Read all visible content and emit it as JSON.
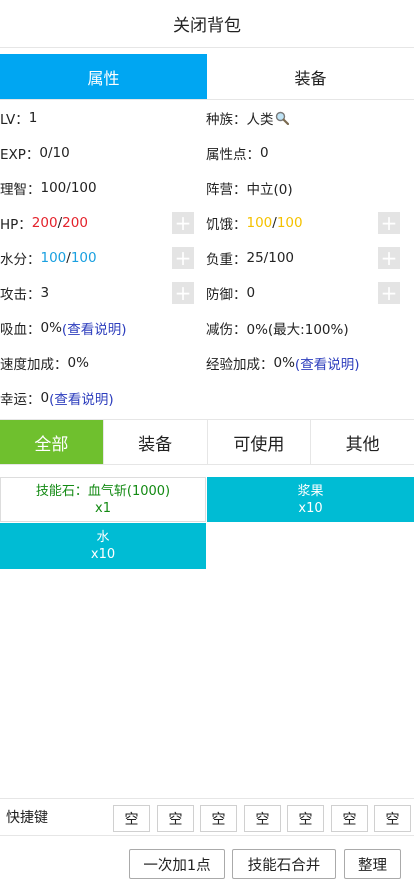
{
  "header": {
    "title": "关闭背包"
  },
  "tabs": [
    {
      "label": "属性"
    },
    {
      "label": "装备"
    }
  ],
  "stats": {
    "lv": {
      "label": "LV：",
      "value": "1"
    },
    "race": {
      "label": "种族：",
      "value": "人类"
    },
    "exp": {
      "label": "EXP：",
      "value": "0/10"
    },
    "attr_points": {
      "label": "属性点：",
      "value": "0"
    },
    "wisdom": {
      "label": "理智：",
      "value": "100/100"
    },
    "camp": {
      "label": "阵营：",
      "value": "中立(0)"
    },
    "hp": {
      "label": "HP：",
      "cur": "200",
      "sep": "/",
      "max": "200"
    },
    "hunger": {
      "label": "饥饿：",
      "cur": "100",
      "sep": "/",
      "max": "100"
    },
    "water": {
      "label": "水分：",
      "cur": "100",
      "sep": "/",
      "max": "100"
    },
    "load": {
      "label": "负重：",
      "value": "25/100"
    },
    "attack": {
      "label": "攻击：",
      "value": "3"
    },
    "defense": {
      "label": "防御：",
      "value": "0"
    },
    "lifesteal": {
      "label": "吸血：",
      "value": "0%",
      "link": "(查看说明)"
    },
    "damage_reduction": {
      "label": "减伤：",
      "value": "0%(最大:100%)"
    },
    "speed_bonus": {
      "label": "速度加成：",
      "value": "0%"
    },
    "exp_bonus": {
      "label": "经验加成：",
      "value": "0%",
      "link": "(查看说明)"
    },
    "luck": {
      "label": "幸运：",
      "value": "0",
      "link": "(查看说明)"
    },
    "plus_symbol": "+"
  },
  "filters": [
    {
      "label": "全部"
    },
    {
      "label": "装备"
    },
    {
      "label": "可使用"
    },
    {
      "label": "其他"
    }
  ],
  "items": [
    {
      "name": "技能石：血气斩(1000)",
      "count": "x1"
    },
    {
      "name": "浆果",
      "count": "x10"
    },
    {
      "name": "水",
      "count": "x10"
    }
  ],
  "quickbar": {
    "label": "快捷键",
    "slots": [
      "空",
      "空",
      "空",
      "空",
      "空",
      "空",
      "空"
    ]
  },
  "actions": {
    "add_one": "一次加1点",
    "merge_stones": "技能石合并",
    "sort": "整理"
  },
  "colors": {
    "tab_active": "#00a6f2",
    "filter_active": "#6fc02e",
    "item_cyan": "#00bcd4",
    "hp": "#e4232c",
    "hunger": "#f5c200",
    "water": "#1aa0e0",
    "link": "#2c3dbd",
    "skill_text": "#138a13"
  }
}
